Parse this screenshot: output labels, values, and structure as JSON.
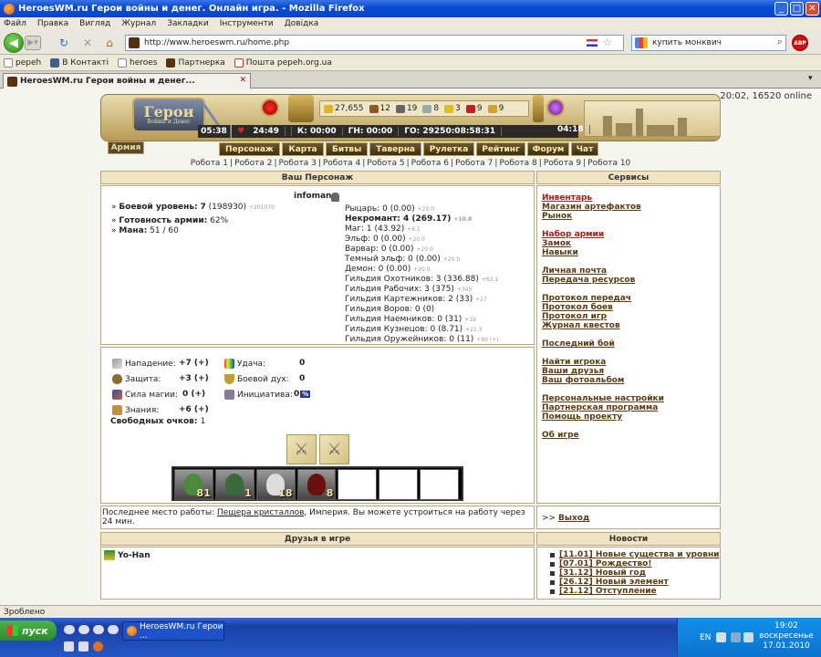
{
  "window": {
    "title": "HeroesWM.ru Герои войны и денег. Онлайн игра. - Mozilla Firefox"
  },
  "menu": [
    "Файл",
    "Правка",
    "Вигляд",
    "Журнал",
    "Закладки",
    "Інструменти",
    "Довідка"
  ],
  "nav": {
    "url": "http://www.heroeswm.ru/home.php",
    "search": "купить монквич",
    "abp": "ABP"
  },
  "bookmarks": [
    "pepeh",
    "В Контакті",
    "heroes",
    "Партнерка",
    "Пошта pepeh.org.ua"
  ],
  "tab": {
    "title": "HeroesWM.ru Герои войны и денег..."
  },
  "online": "20:02, 16520 online",
  "logo": {
    "title": "Герои",
    "subtitle": "Войны и Денег"
  },
  "resources": [
    "27,655",
    "12",
    "19",
    "8",
    "3",
    "9",
    "9"
  ],
  "timers": [
    "05:38",
    "24:49",
    "К: 00:00",
    "ГН: 00:00",
    "ГО: 29250:08:58:31",
    "04:18"
  ],
  "army_label": "Армия",
  "menu_items": [
    "Персонаж",
    "Карта",
    "Битвы",
    "Таверна",
    "Рулетка",
    "Рейтинг",
    "Форум",
    "Чат"
  ],
  "robots": [
    "Робота 1",
    "Робота 2",
    "Робота 3",
    "Робота 4",
    "Робота 5",
    "Робота 6",
    "Робота 7",
    "Робота 8",
    "Робота 9",
    "Робота 10"
  ],
  "headers": {
    "character": "Ваш Персонаж",
    "services": "Сервисы",
    "friends": "Друзья в игре",
    "news": "Новости"
  },
  "character": {
    "name": "infoman",
    "level_label": "Боевой уровень:",
    "level": "7",
    "level_exp": "(198930)",
    "level_next": "+201070",
    "army_ready_label": "Готовность армии:",
    "army_ready": "62%",
    "mana_label": "Мана:",
    "mana": "51 / 60"
  },
  "factions": [
    {
      "name": "Рыцарь:",
      "value": "0 (0.00)",
      "plus": "+20.0"
    },
    {
      "name": "Некромант:",
      "value": "4 (269.17)",
      "plus": "+10.8",
      "bold": true
    },
    {
      "name": "Маг:",
      "value": "1 (43.92)",
      "plus": "+6.1"
    },
    {
      "name": "Эльф:",
      "value": "0 (0.00)",
      "plus": "+20.0"
    },
    {
      "name": "Варвар:",
      "value": "0 (0.00)",
      "plus": "+20.0"
    },
    {
      "name": "Темный эльф:",
      "value": "0 (0.00)",
      "plus": "+20.0"
    },
    {
      "name": "Демон:",
      "value": "0 (0.00)",
      "plus": "+20.0"
    }
  ],
  "guilds": [
    {
      "name": "Гильдия Охотников:",
      "value": "3 (336.88)",
      "plus": "+63.1"
    },
    {
      "name": "Гильдия Рабочих:",
      "value": "3 (375)",
      "plus": "+345"
    },
    {
      "name": "Гильдия Картежников:",
      "value": "2 (33)",
      "plus": "+27"
    },
    {
      "name": "Гильдия Воров:",
      "value": "0 (0)",
      "plus": ""
    },
    {
      "name": "Гильдия Наемников:",
      "value": "0 (31)",
      "plus": "+19"
    },
    {
      "name": "Гильдия Кузнецов:",
      "value": "0 (8.71)",
      "plus": "+21.3"
    },
    {
      "name": "Гильдия Оружейников:",
      "value": "0 (11)",
      "plus": "+90 (+)"
    }
  ],
  "stats": {
    "attack_label": "Нападение:",
    "attack": "+7 (+)",
    "defense_label": "Защита:",
    "defense": "+3 (+)",
    "magic_label": "Сила магии:",
    "magic": "0 (+)",
    "knowledge_label": "Знания:",
    "knowledge": "+6 (+)",
    "luck_label": "Удача:",
    "luck": "0",
    "morale_label": "Боевой дух:",
    "morale": "0",
    "initiative_label": "Инициатива:",
    "initiative": "0",
    "initiative_badge": "%",
    "free_label": "Свободных очков:",
    "free": "1"
  },
  "army_slots": [
    "81",
    "1",
    "18",
    "8"
  ],
  "services": [
    {
      "label": "Инвентарь",
      "red": true
    },
    {
      "label": "Магазин артефактов"
    },
    {
      "label": "Рынок"
    },
    {
      "gap": true
    },
    {
      "label": "Набор армии",
      "red": true
    },
    {
      "label": "Замок"
    },
    {
      "label": "Навыки"
    },
    {
      "gap": true
    },
    {
      "label": "Личная почта"
    },
    {
      "label": "Передача ресурсов"
    },
    {
      "gap": true
    },
    {
      "label": "Протокол передач"
    },
    {
      "label": "Протокол боев"
    },
    {
      "label": "Протокол игр"
    },
    {
      "label": "Журнал квестов"
    },
    {
      "gap": true
    },
    {
      "label": "Последний бой"
    },
    {
      "gap": true
    },
    {
      "label": "Найти игрока"
    },
    {
      "label": "Ваши друзья"
    },
    {
      "label": "Ваш фотоальбом"
    },
    {
      "gap": true
    },
    {
      "label": "Персональные настройки"
    },
    {
      "label": "Партнерская программа"
    },
    {
      "label": "Помощь проекту"
    },
    {
      "gap": true
    },
    {
      "label": "Об игре"
    }
  ],
  "lastwork": {
    "prefix": "Последнее место работы: ",
    "place": "Пещера кристаллов",
    "suffix": ", Империя. Вы можете устроиться на работу через 24 мин."
  },
  "exit": {
    "prefix": ">> ",
    "label": "Выход"
  },
  "friends": [
    "Yo-Han"
  ],
  "news": [
    "[11.01] Новые существа и уровни",
    "[07.01] Рождество!",
    "[31.12] Новый год",
    "[26.12] Новый элемент",
    "[21.12] Отступление"
  ],
  "status": "Зроблено",
  "taskbar": {
    "start": "пуск",
    "item": "HeroesWM.ru Герои ...",
    "lang": "EN",
    "time": "19:02",
    "day": "воскресенье",
    "date": "17.01.2010"
  }
}
